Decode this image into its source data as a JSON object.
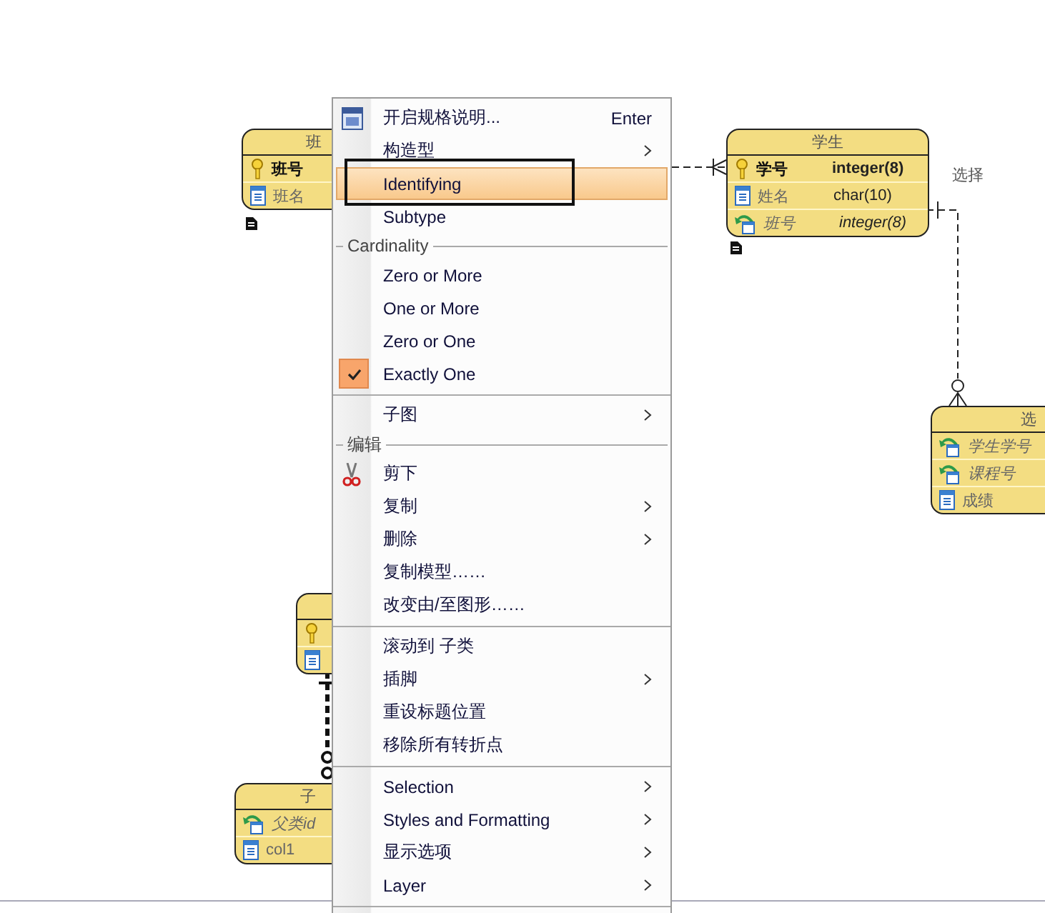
{
  "entities": [
    {
      "title": "班",
      "has_note": true,
      "rows": [
        {
          "kind": "key",
          "name": "班号"
        },
        {
          "kind": "column",
          "name": "班名"
        }
      ]
    },
    {
      "title": "学生",
      "has_note": true,
      "rows": [
        {
          "kind": "key",
          "name": "学号",
          "type": "integer(8)"
        },
        {
          "kind": "column",
          "name": "姓名",
          "type": "char(10)"
        },
        {
          "kind": "foreign",
          "name": "班号",
          "type": "integer(8)"
        }
      ]
    },
    {
      "title": "选",
      "has_note": false,
      "rows": [
        {
          "kind": "foreign",
          "name": "学生学号"
        },
        {
          "kind": "foreign",
          "name": "课程号"
        },
        {
          "kind": "column",
          "name": "成绩"
        }
      ]
    },
    {
      "has_note": false,
      "rows": [
        {
          "kind": "key"
        },
        {
          "kind": "column"
        }
      ]
    },
    {
      "title": "子",
      "has_note": false,
      "rows": [
        {
          "kind": "foreign",
          "name": "父类id"
        },
        {
          "kind": "column",
          "name": "col1"
        }
      ]
    }
  ],
  "connector_label": "选择",
  "menu": [
    {
      "kind": "spec",
      "label": "开启规格说明...",
      "shortcut": "Enter",
      "submenu": false,
      "selected": false
    },
    {
      "kind": "item",
      "label": "构造型",
      "submenu": true,
      "selected": false
    },
    {
      "kind": "item",
      "label": "Identifying",
      "submenu": false,
      "selected": true
    },
    {
      "kind": "item",
      "label": "Subtype",
      "submenu": false,
      "selected": false
    },
    {
      "kind": "header",
      "label": "Cardinality"
    },
    {
      "kind": "check",
      "label": "Zero or More",
      "checked": false,
      "submenu": false,
      "selected": false
    },
    {
      "kind": "check",
      "label": "One or More",
      "checked": false,
      "submenu": false,
      "selected": false
    },
    {
      "kind": "check",
      "label": "Zero or One",
      "checked": false,
      "submenu": false,
      "selected": false
    },
    {
      "kind": "check",
      "label": "Exactly One",
      "checked": true,
      "submenu": false,
      "selected": false
    },
    {
      "kind": "separator"
    },
    {
      "kind": "item",
      "label": "子图",
      "submenu": true,
      "selected": false
    },
    {
      "kind": "header",
      "label": "编辑"
    },
    {
      "kind": "cut",
      "label": "剪下",
      "submenu": false,
      "selected": false
    },
    {
      "kind": "item",
      "label": "复制",
      "submenu": true,
      "selected": false
    },
    {
      "kind": "item",
      "label": "删除",
      "submenu": true,
      "selected": false
    },
    {
      "kind": "item",
      "label": "复制模型……",
      "submenu": false,
      "selected": false
    },
    {
      "kind": "item",
      "label": "改变由/至图形……",
      "submenu": false,
      "selected": false
    },
    {
      "kind": "separator"
    },
    {
      "kind": "item",
      "label": "滚动到 子类",
      "submenu": false,
      "selected": false
    },
    {
      "kind": "item",
      "label": "插脚",
      "submenu": true,
      "selected": false
    },
    {
      "kind": "item",
      "label": "重设标题位置",
      "submenu": false,
      "selected": false
    },
    {
      "kind": "item",
      "label": "移除所有转折点",
      "submenu": false,
      "selected": false
    },
    {
      "kind": "separator"
    },
    {
      "kind": "item",
      "label": "Selection",
      "submenu": true,
      "selected": false
    },
    {
      "kind": "item",
      "label": "Styles and Formatting",
      "submenu": true,
      "selected": false
    },
    {
      "kind": "item",
      "label": "显示选项",
      "submenu": true,
      "selected": false
    },
    {
      "kind": "item",
      "label": "Layer",
      "submenu": true,
      "selected": false
    },
    {
      "kind": "separator"
    }
  ]
}
